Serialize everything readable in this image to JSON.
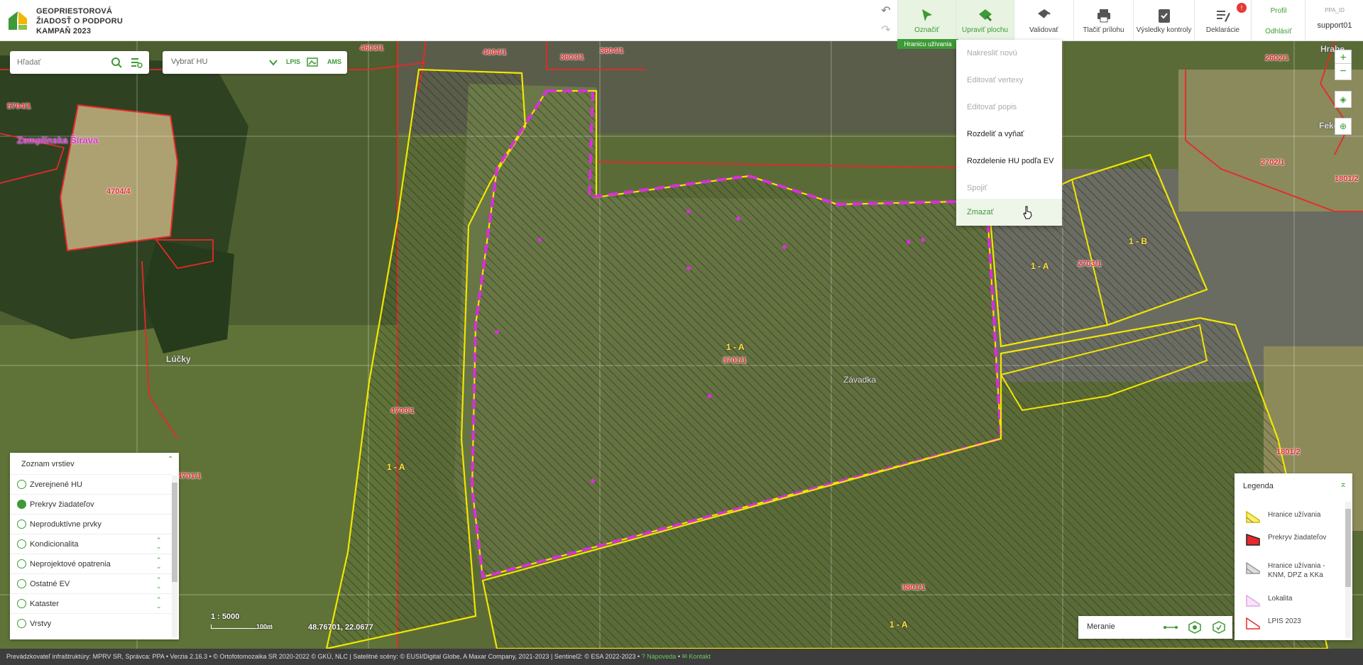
{
  "header": {
    "title_line1": "GEOPRIESTOROVÁ",
    "title_line2": "ŽIADOSŤ O PODPORU",
    "title_line3": "KAMPAŇ 2023",
    "tools": [
      {
        "label": "Označiť"
      },
      {
        "label": "Upraviť plochu"
      },
      {
        "label": "Validovať"
      },
      {
        "label": "Tlačiť prílohu"
      },
      {
        "label": "Výsledky kontroly"
      },
      {
        "label": "Deklarácie"
      }
    ],
    "notification_count": "!",
    "badge": "Hranicu užívania",
    "profile_label": "Profil",
    "logout_label": "Odhlásiť",
    "ppa_id_label": "PPA_ID",
    "username": "support01"
  },
  "search": {
    "placeholder": "Hľadať",
    "select_placeholder": "Vybrať HU",
    "lpis_label": "LPIS",
    "ams_label": "AMS"
  },
  "edit_menu": {
    "items": [
      {
        "label": "Nakresliť novú"
      },
      {
        "label": "Editovať vertexy"
      },
      {
        "label": "Editovať popis"
      },
      {
        "label": "Rozdeliť a vyňať"
      },
      {
        "label": "Rozdelenie HU podľa EV"
      },
      {
        "label": "Spojiť"
      },
      {
        "label": "Zmazať"
      }
    ]
  },
  "map_labels": {
    "red": [
      "4603/1",
      "4604/1",
      "3603/1",
      "3604/1",
      "5704/1",
      "4704/4",
      "2602/1",
      "2702/1",
      "1801/2",
      "1801/2",
      "2703/1",
      "4703/1",
      "3701/1",
      "4701/1",
      "3801/1"
    ],
    "yellow": [
      "1 - A",
      "1 - A",
      "1 - B",
      "1 - A",
      "1 - A"
    ],
    "white": [
      "Lúčky",
      "Závadka",
      "Hrabe",
      "Feko"
    ],
    "place": "Zemplínska Šírava"
  },
  "layers": {
    "title": "Zoznam vrstiev",
    "items": [
      {
        "label": "Zverejnené HU"
      },
      {
        "label": "Prekryv žiadateľov"
      },
      {
        "label": "Neproduktívne prvky"
      },
      {
        "label": "Kondicionalita"
      },
      {
        "label": "Neprojektové opatrenia"
      },
      {
        "label": "Ostatné EV"
      },
      {
        "label": "Kataster"
      },
      {
        "label": "Vrstvy"
      }
    ]
  },
  "legend": {
    "title": "Legenda",
    "items": [
      {
        "label": "Hranice užívania"
      },
      {
        "label": "Prekryv žiadateľov"
      },
      {
        "label": "Hranice užívania - KNM, DPZ a KKa"
      },
      {
        "label": "Lokalita"
      },
      {
        "label": "LPIS 2023"
      }
    ]
  },
  "measure": {
    "label": "Meranie"
  },
  "scale": {
    "ratio": "1 : 5000",
    "bar_label": "100m",
    "coords": "48.76701, 22.0677"
  },
  "footer": {
    "text": "Prevádzkovateľ infraštruktúry: MPRV SR, Správca: PPA • Verzia 2.16.3 • © Ortofotomozaika SR 2020-2022 © GKÚ, NLC | Satelitné scény: © EUSI/Digital Globe, A Maxar Company, 2021-2023 | Sentinel2: © ESA 2022-2023 •",
    "help": "Nápoveda",
    "contact": "Kontakt"
  },
  "colors": {
    "accent": "#3e9a36",
    "parcel_red": "#e8282a",
    "hu_yellow": "#f2e600",
    "overlap_magenta": "#d92fd9"
  }
}
